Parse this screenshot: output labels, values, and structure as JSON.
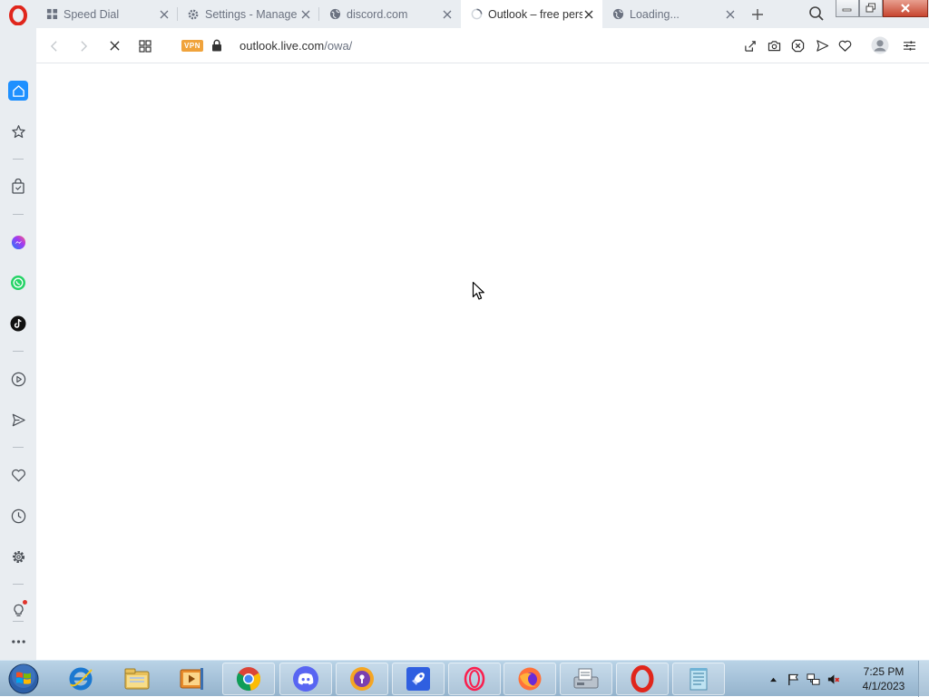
{
  "browser": {
    "tabs": [
      {
        "title": "Speed Dial",
        "icon": "grid-icon",
        "active": false
      },
      {
        "title": "Settings - Manage",
        "icon": "gear-icon",
        "active": false
      },
      {
        "title": "discord.com",
        "icon": "globe-icon",
        "active": false
      },
      {
        "title": "Outlook – free pers",
        "icon": "loading-spinner-icon",
        "active": true
      },
      {
        "title": "Loading...",
        "icon": "globe-icon",
        "active": false
      }
    ],
    "address": {
      "vpn_label": "VPN",
      "host": "outlook.live.com",
      "path": "/owa/"
    }
  },
  "sidebar": {
    "items": [
      "home-icon",
      "star-icon",
      "shopping-bag-icon",
      "messenger-icon",
      "whatsapp-icon",
      "tiktok-icon",
      "player-icon",
      "send-icon",
      "heart-icon",
      "history-icon",
      "gear-icon",
      "lightbulb-icon",
      "more-icon"
    ]
  },
  "taskbar": {
    "apps": [
      "internet-explorer-icon",
      "file-explorer-icon",
      "media-player-icon",
      "chrome-icon",
      "discord-icon",
      "shield-icon",
      "rocket-icon",
      "opera-gx-icon",
      "firefox-icon",
      "fax-icon",
      "opera-icon",
      "notepad-icon"
    ],
    "clock": {
      "time": "7:25 PM",
      "date": "4/1/2023"
    }
  },
  "colors": {
    "accent": "#1e90ff",
    "opera_red": "#e0261c",
    "vpn_orange": "#f0a33c"
  }
}
